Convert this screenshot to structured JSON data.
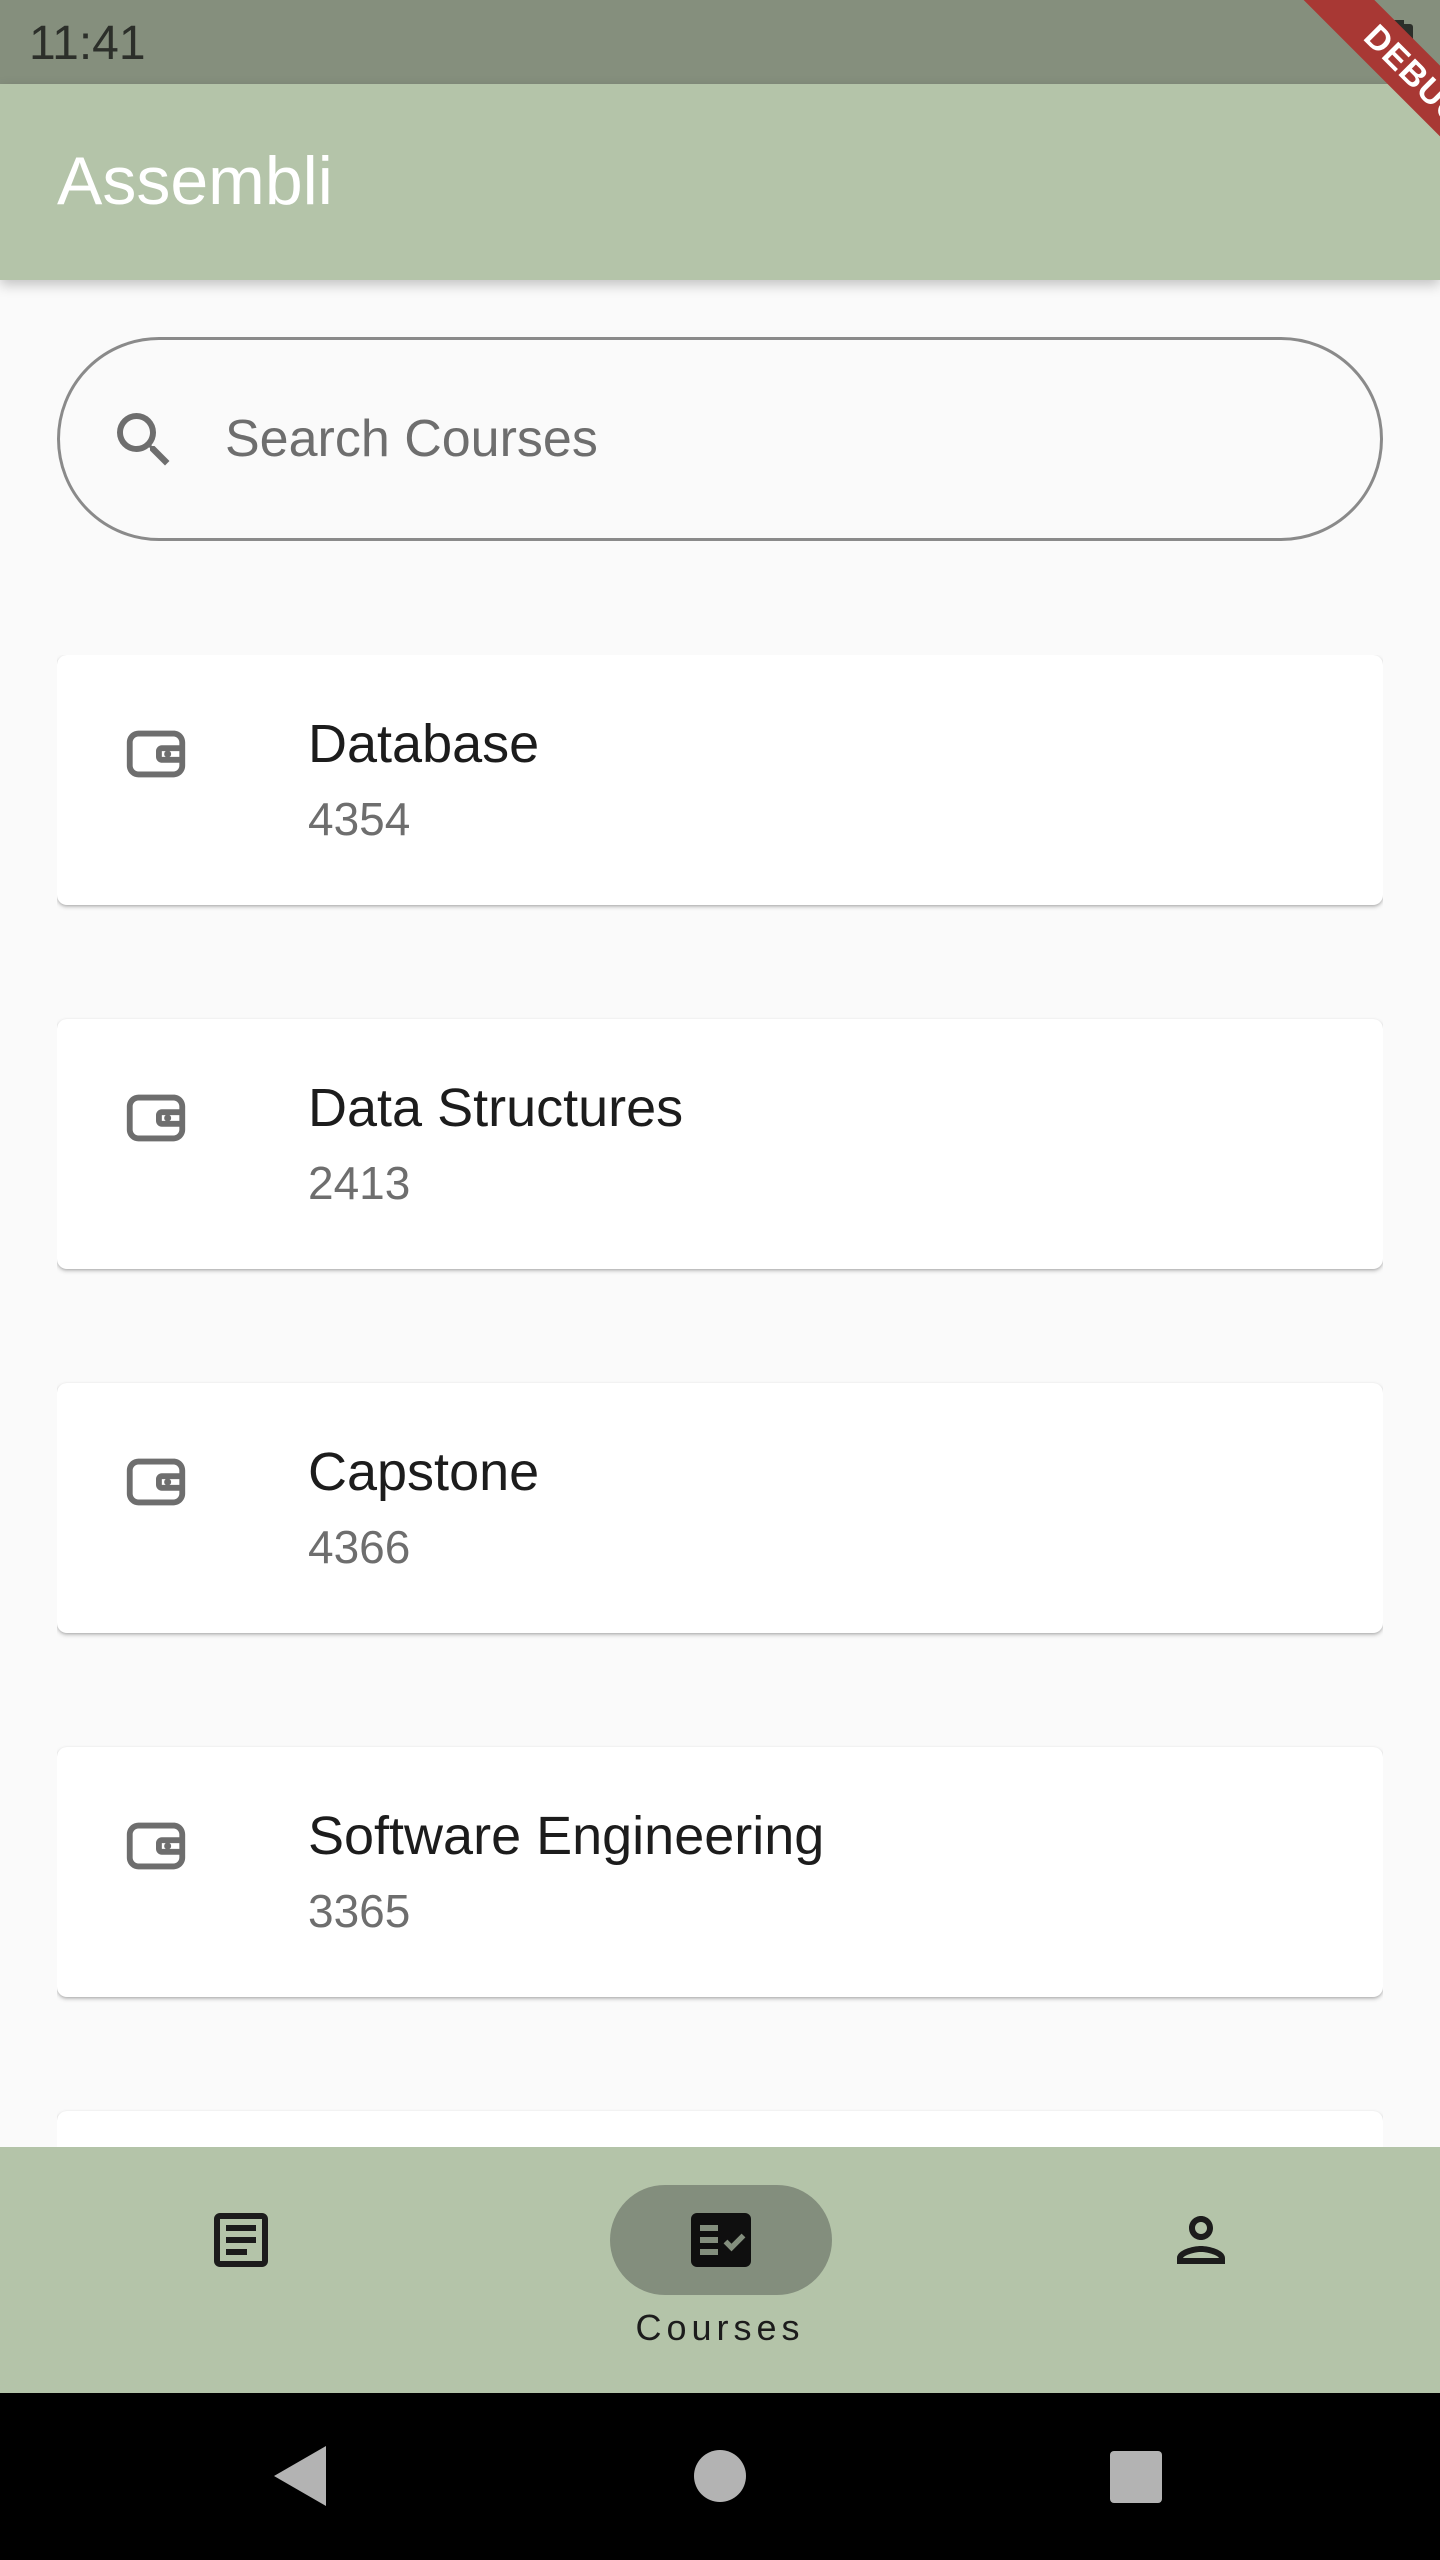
{
  "status_bar": {
    "time": "11:41",
    "icons": [
      "battery-icon"
    ]
  },
  "debug_banner": {
    "label": "DEBUG"
  },
  "app_bar": {
    "title": "Assembli"
  },
  "search": {
    "placeholder": "Search Courses",
    "value": "",
    "icon": "search-icon"
  },
  "courses": [
    {
      "title": "Database",
      "number": "4354",
      "icon": "wallet-icon"
    },
    {
      "title": "Data Structures",
      "number": "2413",
      "icon": "wallet-icon"
    },
    {
      "title": "Capstone",
      "number": "4366",
      "icon": "wallet-icon"
    },
    {
      "title": "Software Engineering",
      "number": "3365",
      "icon": "wallet-icon"
    },
    {
      "title": "",
      "number": "",
      "icon": "wallet-icon"
    }
  ],
  "bottom_nav": {
    "items": [
      {
        "label": "",
        "icon": "article-icon",
        "selected": false
      },
      {
        "label": "Courses",
        "icon": "fact-check-icon",
        "selected": true
      },
      {
        "label": "",
        "icon": "person-icon",
        "selected": false
      }
    ]
  },
  "system_nav": {
    "buttons": [
      "back-icon",
      "home-icon",
      "recents-icon"
    ]
  },
  "colors": {
    "status_bar": "#858f7d",
    "app_bar": "#b4c4a9",
    "nav_pill": "#838e7d",
    "debug_banner": "#a83834",
    "background": "#fafafa"
  }
}
